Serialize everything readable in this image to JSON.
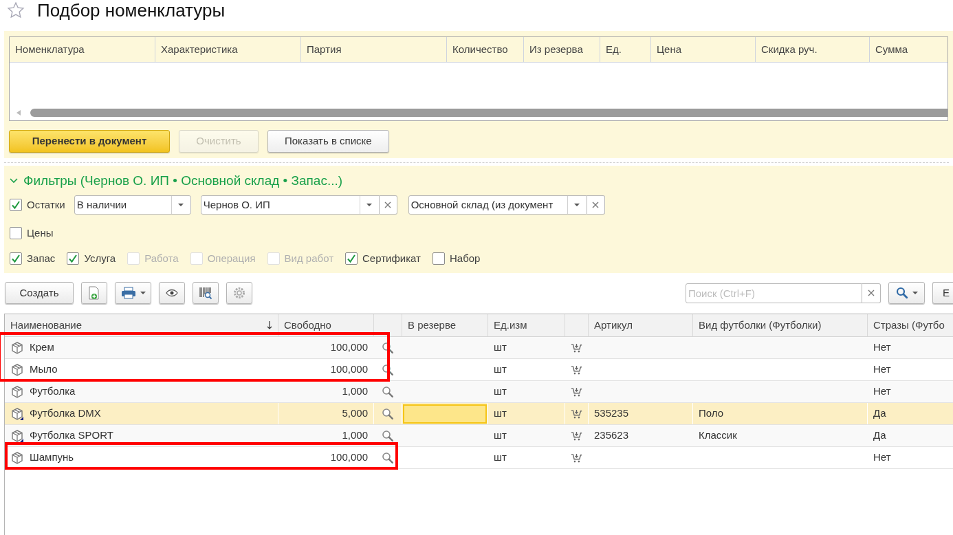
{
  "window": {
    "title": "Подбор номенклатуры",
    "favorite": false
  },
  "selection_table": {
    "columns": [
      "Номенклатура",
      "Характеристика",
      "Партия",
      "Количество",
      "Из резерва",
      "Ед.",
      "Цена",
      "Скидка руч.",
      "Сумма"
    ]
  },
  "selection_buttons": [
    {
      "label": "Перенести в документ",
      "kind": "primary",
      "disabled": false
    },
    {
      "label": "Очистить",
      "kind": "normal",
      "disabled": true
    },
    {
      "label": "Показать в списке",
      "kind": "normal",
      "disabled": false
    }
  ],
  "filters": {
    "title": "Фильтры (Чернов О. ИП • Основной склад • Запас...)",
    "expanded": true,
    "stock": {
      "label": "Остатки",
      "checked": true,
      "mode": "В наличии",
      "organization": "Чернов О. ИП",
      "warehouse": "Основной склад (из документ"
    },
    "prices": {
      "label": "Цены",
      "checked": false
    },
    "types": [
      {
        "label": "Запас",
        "checked": true,
        "disabled": false
      },
      {
        "label": "Услуга",
        "checked": true,
        "disabled": false
      },
      {
        "label": "Работа",
        "checked": false,
        "disabled": true
      },
      {
        "label": "Операция",
        "checked": false,
        "disabled": true
      },
      {
        "label": "Вид работ",
        "checked": false,
        "disabled": true
      },
      {
        "label": "Сертификат",
        "checked": true,
        "disabled": false
      },
      {
        "label": "Набор",
        "checked": false,
        "disabled": false
      }
    ]
  },
  "toolbar": {
    "create": "Создать",
    "search_placeholder": "Поиск (Ctrl+F)",
    "more": "Е"
  },
  "table": {
    "columns": [
      "Наименование",
      "Свободно",
      "В резерве",
      "Ед.изм",
      "Артикул",
      "Вид футболки (Футболки)",
      "Стразы (Футбо"
    ],
    "rows": [
      {
        "name": "Крем",
        "free": "100,000",
        "unit": "шт",
        "article": "",
        "tshirt_kind": "",
        "rhinestones": "Нет",
        "selected": false,
        "marked": false,
        "highlighted": true
      },
      {
        "name": "Мыло",
        "free": "100,000",
        "unit": "шт",
        "article": "",
        "tshirt_kind": "",
        "rhinestones": "Нет",
        "selected": false,
        "marked": false,
        "highlighted": true
      },
      {
        "name": "Футболка",
        "free": "1,000",
        "unit": "шт",
        "article": "",
        "tshirt_kind": "",
        "rhinestones": "Нет",
        "selected": false,
        "marked": false,
        "highlighted": false
      },
      {
        "name": "Футболка DMX",
        "free": "5,000",
        "unit": "шт",
        "article": "535235",
        "tshirt_kind": "Поло",
        "rhinestones": "Да",
        "selected": true,
        "marked": true,
        "highlighted": false
      },
      {
        "name": "Футболка SPORT",
        "free": "1,000",
        "unit": "шт",
        "article": "235623",
        "tshirt_kind": "Классик",
        "rhinestones": "Да",
        "selected": false,
        "marked": true,
        "highlighted": false
      },
      {
        "name": "Шампунь",
        "free": "100,000",
        "unit": "шт",
        "article": "",
        "tshirt_kind": "",
        "rhinestones": "Нет",
        "selected": false,
        "marked": false,
        "highlighted": true
      }
    ]
  }
}
